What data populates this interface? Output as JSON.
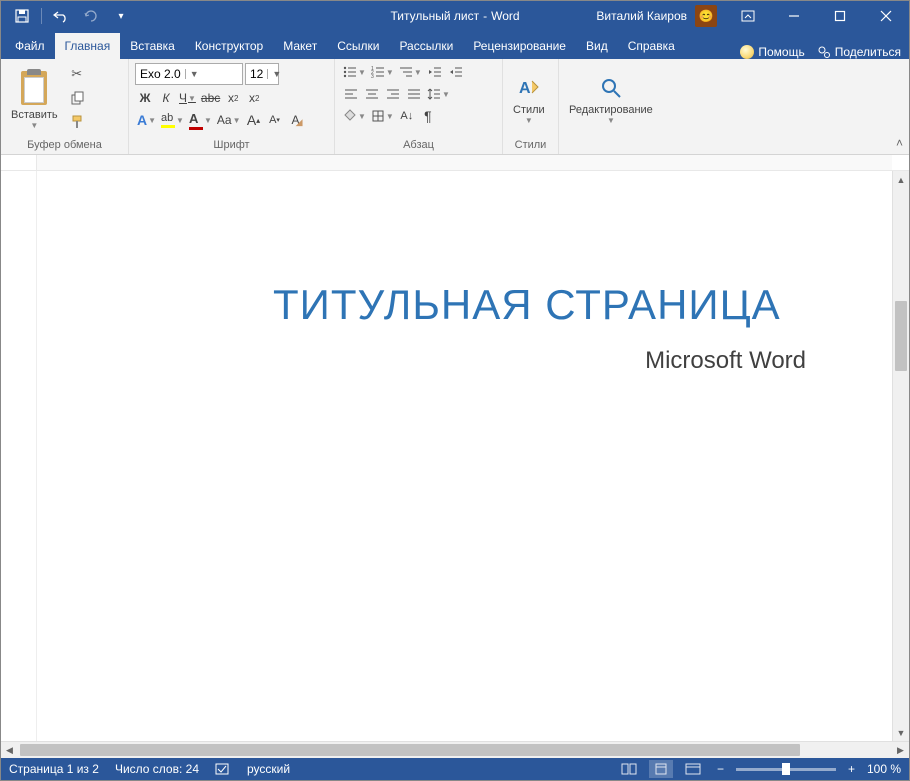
{
  "title": {
    "doc": "Титульный лист",
    "sep": "-",
    "app": "Word"
  },
  "user": "Виталий Каиров",
  "tabs": {
    "file": "Файл",
    "home": "Главная",
    "insert": "Вставка",
    "design": "Конструктор",
    "layout": "Макет",
    "references": "Ссылки",
    "mailings": "Рассылки",
    "review": "Рецензирование",
    "view": "Вид",
    "help": "Справка",
    "tellme": "Помощь",
    "share": "Поделиться"
  },
  "ribbon": {
    "clipboard": {
      "paste": "Вставить",
      "label": "Буфер обмена"
    },
    "font": {
      "name": "Exo 2.0",
      "size": "12",
      "label": "Шрифт",
      "bold": "Ж",
      "italic": "К",
      "underline": "Ч",
      "strike": "abc",
      "sub": "x₂",
      "sup": "x²",
      "effects": "A",
      "highlight": "A",
      "color": "A",
      "case": "Aa",
      "grow": "A",
      "shrink": "A",
      "clear": "A"
    },
    "paragraph": {
      "label": "Абзац"
    },
    "styles": {
      "btn": "Стили",
      "label": "Стили"
    },
    "editing": {
      "btn": "Редактирование"
    }
  },
  "document": {
    "title": "ТИТУЛЬНАЯ СТРАНИЦА",
    "subtitle": "Microsoft Word"
  },
  "status": {
    "page": "Страница 1 из 2",
    "words": "Число слов: 24",
    "lang": "русский",
    "zoom": "100 %"
  }
}
